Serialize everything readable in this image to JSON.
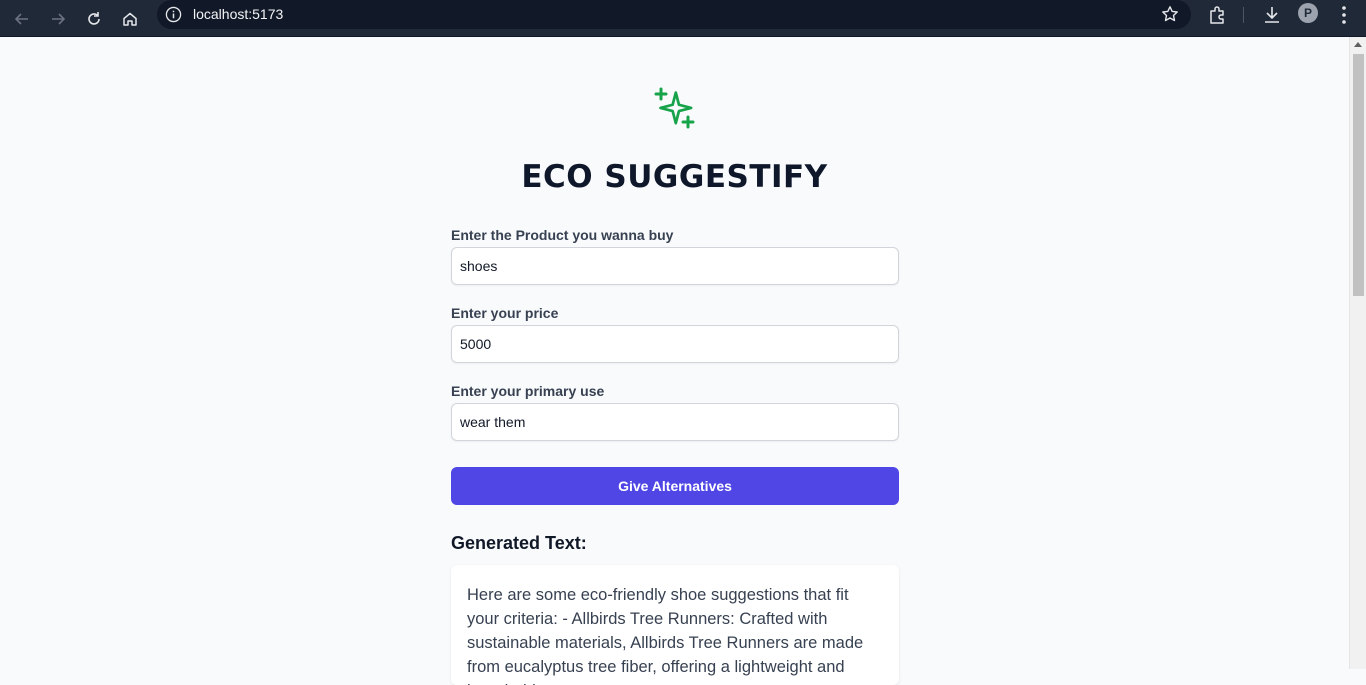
{
  "browser": {
    "url": "localhost:5173",
    "profile_initial": "P"
  },
  "app": {
    "title": "ECO SUGGESTIFY",
    "logo_icon": "sparkles-icon",
    "accent_color": "#16a34a",
    "button_color": "#4f46e5"
  },
  "form": {
    "product": {
      "label": "Enter the Product you wanna buy",
      "value": "shoes"
    },
    "price": {
      "label": "Enter your price",
      "value": "5000"
    },
    "use": {
      "label": "Enter your primary use",
      "value": "wear them"
    },
    "submit_label": "Give Alternatives"
  },
  "result": {
    "heading": "Generated Text:",
    "text": "Here are some eco-friendly shoe suggestions that fit your criteria: - Allbirds Tree Runners: Crafted with sustainable materials, Allbirds Tree Runners are made from eucalyptus tree fiber, offering a lightweight and breathable"
  }
}
